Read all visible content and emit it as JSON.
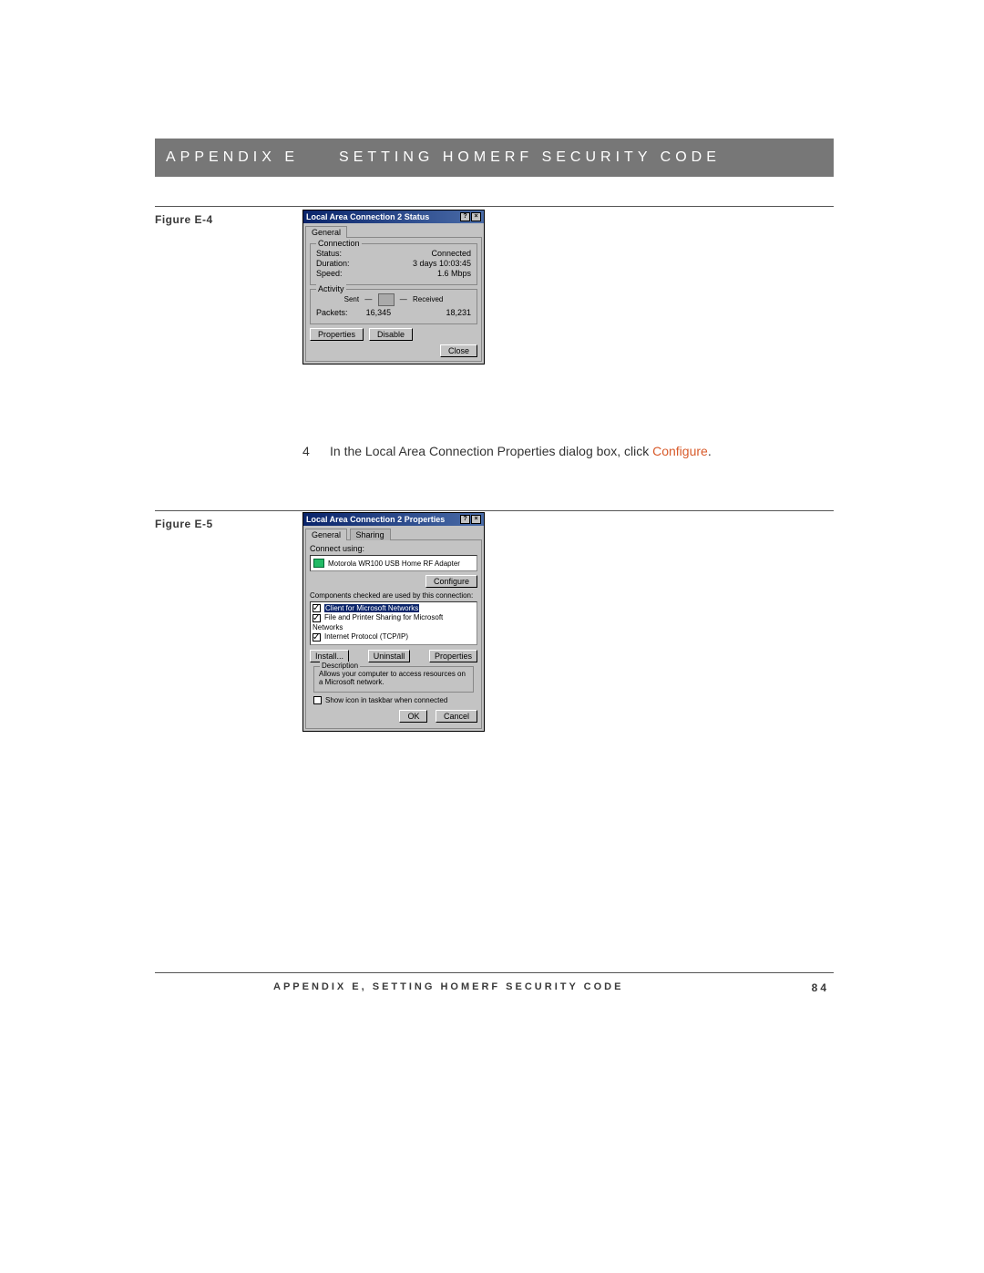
{
  "header": {
    "appendix": "APPENDIX E",
    "title": "SETTING HOMERF SECURITY CODE"
  },
  "figureE4": "Figure E-4",
  "figureE5": "Figure E-5",
  "instruction": {
    "num": "4",
    "before": "In the Local Area Connection Properties dialog box, click ",
    "link": "Configure",
    "after": "."
  },
  "footer": {
    "text": "APPENDIX E, SETTING HOMERF SECURITY CODE",
    "page": "84"
  },
  "dlg1": {
    "title": "Local Area Connection 2 Status",
    "tab": "General",
    "group_conn": "Connection",
    "status_l": "Status:",
    "status_v": "Connected",
    "dur_l": "Duration:",
    "dur_v": "3 days 10:03:45",
    "speed_l": "Speed:",
    "speed_v": "1.6 Mbps",
    "group_act": "Activity",
    "sent": "Sent",
    "recv": "Received",
    "packets_l": "Packets:",
    "packets_sent": "16,345",
    "packets_recv": "18,231",
    "btn_props": "Properties",
    "btn_disable": "Disable",
    "btn_close": "Close"
  },
  "dlg2": {
    "title": "Local Area Connection 2 Properties",
    "tab1": "General",
    "tab2": "Sharing",
    "connect_using": "Connect using:",
    "adapter": "Motorola WR100 USB Home RF Adapter",
    "btn_configure": "Configure",
    "components_label": "Components checked are used by this connection:",
    "item1": "Client for Microsoft Networks",
    "item2": "File and Printer Sharing for Microsoft Networks",
    "item3": "Internet Protocol (TCP/IP)",
    "btn_install": "Install...",
    "btn_uninstall": "Uninstall",
    "btn_properties": "Properties",
    "desc_legend": "Description",
    "desc_text": "Allows your computer to access resources on a Microsoft network.",
    "show_icon": "Show icon in taskbar when connected",
    "btn_ok": "OK",
    "btn_cancel": "Cancel"
  }
}
